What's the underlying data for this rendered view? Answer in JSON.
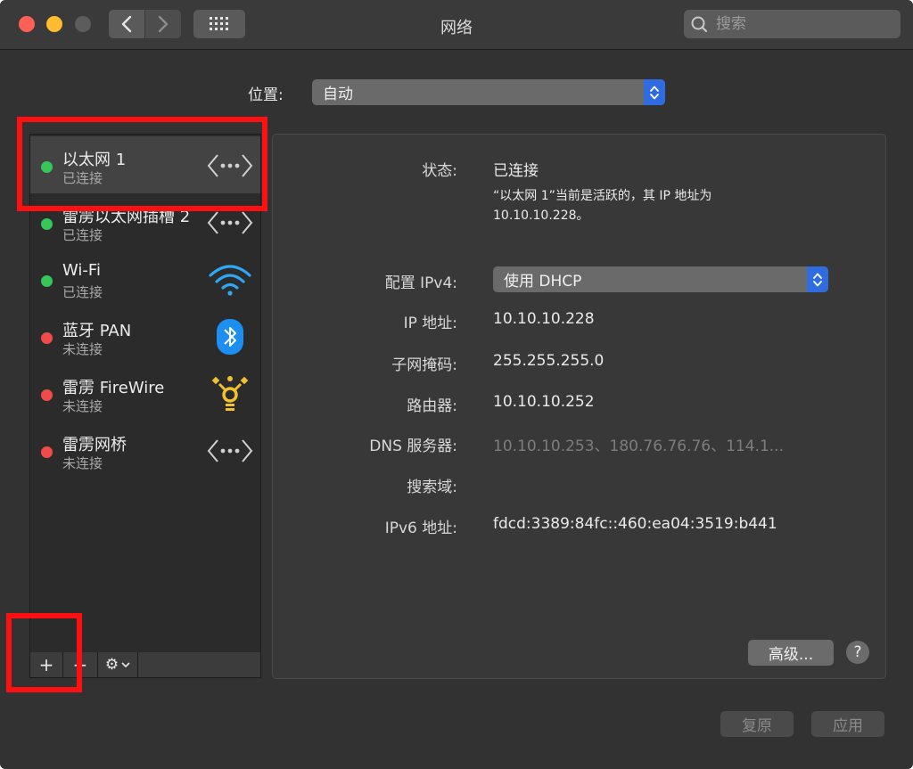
{
  "window": {
    "title": "网络"
  },
  "search": {
    "placeholder": "搜索"
  },
  "location": {
    "label": "位置:",
    "value": "自动"
  },
  "services": [
    {
      "name": "以太网 1",
      "status": "已连接",
      "state": "connected",
      "icon": "ethernet-icon"
    },
    {
      "name": "雷雳以太网插槽 2",
      "status": "已连接",
      "state": "connected",
      "icon": "ethernet-icon"
    },
    {
      "name": "Wi-Fi",
      "status": "已连接",
      "state": "connected",
      "icon": "wifi-icon"
    },
    {
      "name": "蓝牙 PAN",
      "status": "未连接",
      "state": "disconnected",
      "icon": "bluetooth-icon"
    },
    {
      "name": "雷雳 FireWire",
      "status": "未连接",
      "state": "disconnected",
      "icon": "firewire-icon"
    },
    {
      "name": "雷雳网桥",
      "status": "未连接",
      "state": "disconnected",
      "icon": "ethernet-icon"
    }
  ],
  "footer": {
    "add": "+",
    "remove": "−",
    "gear": "⚙"
  },
  "detail": {
    "status_label": "状态:",
    "status_value": "已连接",
    "status_desc_1": "“以太网 1”当前是活跃的，其 IP 地址为",
    "status_desc_2": "10.10.10.228。",
    "config_label": "配置 IPv4:",
    "config_value": "使用 DHCP",
    "ip_label": "IP 地址:",
    "ip_value": "10.10.10.228",
    "mask_label": "子网掩码:",
    "mask_value": "255.255.255.0",
    "router_label": "路由器:",
    "router_value": "10.10.10.252",
    "dns_label": "DNS 服务器:",
    "dns_value": "10.10.10.253、180.76.76.76、114.1...",
    "search_label": "搜索域:",
    "ipv6_label": "IPv6 地址:",
    "ipv6_value": "fdcd:3389:84fc::460:ea04:3519:b441",
    "advanced": "高级...",
    "help": "?"
  },
  "buttons": {
    "revert": "复原",
    "apply": "应用"
  },
  "colors": {
    "accent": "#2f6ce0",
    "connected": "#35c759",
    "disconnected": "#f04a4a",
    "annotation": "#ff1010"
  }
}
